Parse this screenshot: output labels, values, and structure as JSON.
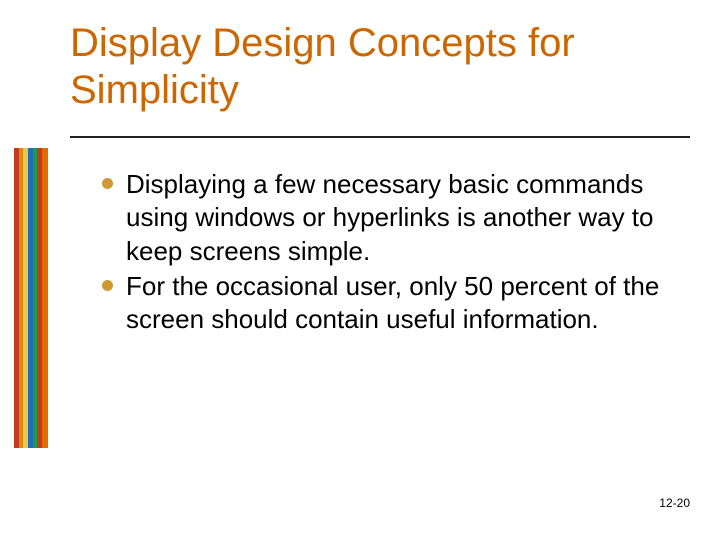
{
  "title": "Display Design Concepts for Simplicity",
  "bullets": [
    "Displaying a few necessary basic commands using windows or hyperlinks is another way to keep screens simple.",
    "For the occasional user, only 50 percent of the screen should contain useful information."
  ],
  "page_number": "12-20",
  "stripe_colors": [
    "#c43a1e",
    "#d88a14",
    "#e7c84a",
    "#1f6fb7",
    "#1a9c4a",
    "#c43a1e",
    "#e06c00"
  ]
}
